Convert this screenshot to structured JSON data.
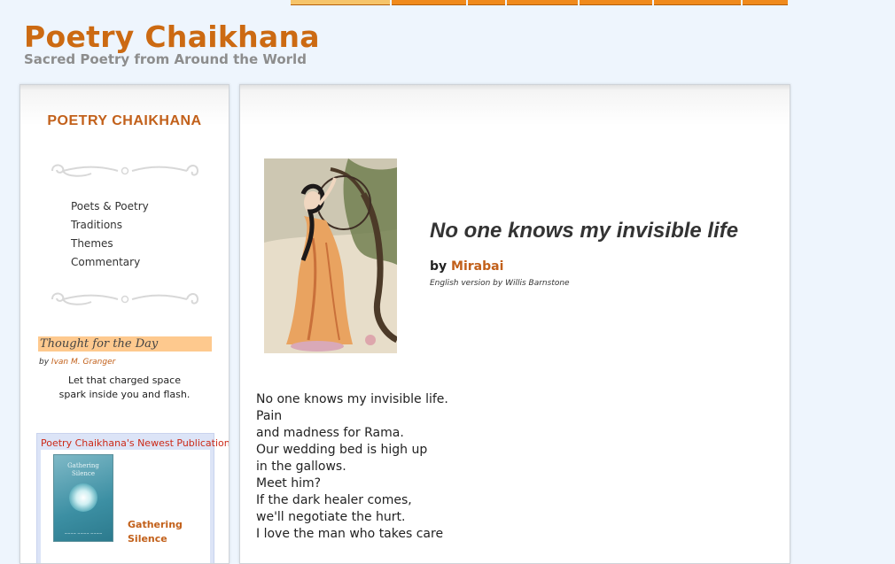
{
  "site": {
    "title": "Poetry Chaikhana",
    "subtitle": "Sacred Poetry from Around the World"
  },
  "top_nav": {
    "tab_count": 8,
    "active_index": 0,
    "color": "#f08a1c",
    "active_color": "#f6c46a"
  },
  "sidebar": {
    "title": "POETRY CHAIKHANA",
    "nav_items": [
      {
        "label": "Poets & Poetry"
      },
      {
        "label": "Traditions"
      },
      {
        "label": "Themes"
      },
      {
        "label": "Commentary"
      }
    ],
    "thought": {
      "header": "Thought for the Day",
      "by_prefix": "by",
      "author": "Ivan M. Granger",
      "lines": [
        "Let that charged space",
        "spark inside you and flash."
      ]
    },
    "publication": {
      "heading": "Poetry Chaikhana's Newest Publication",
      "book_title_lines": [
        "Gathering",
        "Silence"
      ],
      "cover_title": "Gathering Silence"
    }
  },
  "poem": {
    "title": "No one knows my invisible life",
    "by_prefix": "by",
    "author": "Mirabai",
    "translator_note": "English version by Willis Barnstone",
    "lines": [
      "No one knows my invisible life.",
      "Pain",
      "and madness for Rama.",
      "Our wedding bed is high up",
      "in the gallows.",
      "Meet him?",
      "If the dark healer comes,",
      "we'll negotiate the hurt.",
      "I love the man who takes care"
    ]
  },
  "colors": {
    "accent": "#cc6a12",
    "page_background": "#eef5fd",
    "thought_header_bg": "#fec98e",
    "publication_heading": "#cc2a18"
  }
}
